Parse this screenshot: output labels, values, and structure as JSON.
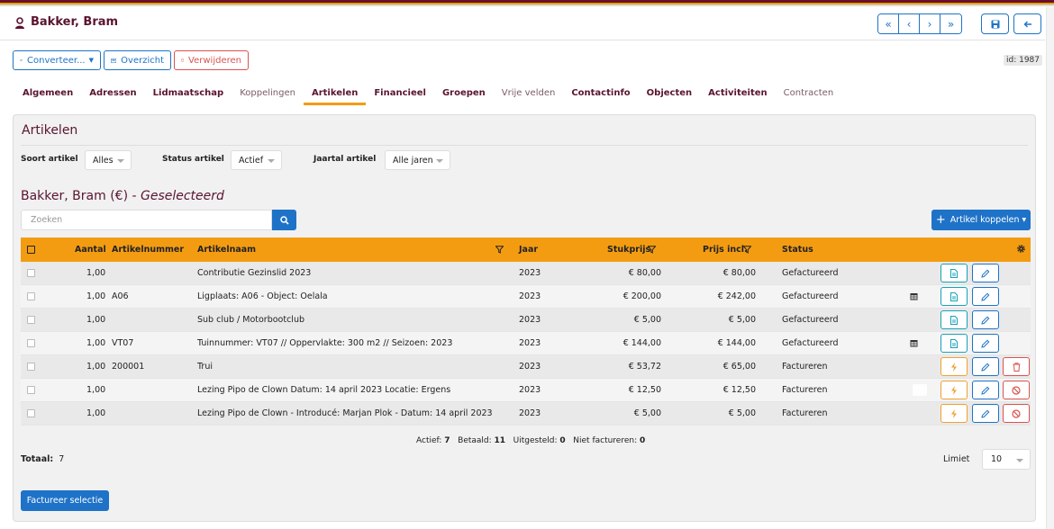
{
  "header": {
    "title": "Bakker, Bram",
    "nav": [
      "«",
      "‹",
      "›",
      "»"
    ],
    "save_icon": "save-icon",
    "back_icon": "arrow-left-icon"
  },
  "toolbar": {
    "convert_label": "Converteer...",
    "overview_label": "Overzicht",
    "delete_label": "Verwijderen",
    "id_label": "id: 1987"
  },
  "tabs": [
    {
      "label": "Algemeen",
      "style": "bold"
    },
    {
      "label": "Adressen",
      "style": "bold"
    },
    {
      "label": "Lidmaatschap",
      "style": "bold"
    },
    {
      "label": "Koppelingen",
      "style": "muted"
    },
    {
      "label": "Artikelen",
      "style": "active"
    },
    {
      "label": "Financieel",
      "style": "bold"
    },
    {
      "label": "Groepen",
      "style": "bold"
    },
    {
      "label": "Vrije velden",
      "style": "muted"
    },
    {
      "label": "Contactinfo",
      "style": "bold"
    },
    {
      "label": "Objecten",
      "style": "bold"
    },
    {
      "label": "Activiteiten",
      "style": "bold"
    },
    {
      "label": "Contracten",
      "style": "muted"
    }
  ],
  "panel": {
    "title": "Artikelen",
    "filters": {
      "soort_label": "Soort artikel",
      "soort_value": "Alles",
      "status_label": "Status artikel",
      "status_value": "Actief",
      "jaartal_label": "Jaartal artikel",
      "jaartal_value": "Alle jaren"
    },
    "subtitle_main": "Bakker, Bram (€) - ",
    "subtitle_em": "Geselecteerd",
    "search_placeholder": "Zoeken",
    "add_label": "Artikel koppelen"
  },
  "table": {
    "headers": {
      "aantal": "Aantal",
      "artikelnummer": "Artikelnummer",
      "artikelnaam": "Artikelnaam",
      "jaar": "Jaar",
      "stukprijs": "Stukprijs",
      "prijs_incl": "Prijs incl.",
      "status": "Status"
    },
    "rows": [
      {
        "aantal": "1,00",
        "nummer": "",
        "naam": "Contributie Gezinslid 2023",
        "jaar": "2023",
        "stukprijs": "€ 80,00",
        "prijs": "€ 80,00",
        "status": "Gefactureerd",
        "calendar": false,
        "type": "invoiced"
      },
      {
        "aantal": "1,00",
        "nummer": "A06",
        "naam": "Ligplaats: A06 - Object: Oelala",
        "jaar": "2023",
        "stukprijs": "€ 200,00",
        "prijs": "€ 242,00",
        "status": "Gefactureerd",
        "calendar": true,
        "type": "invoiced"
      },
      {
        "aantal": "1,00",
        "nummer": "",
        "naam": "Sub club / Motorbootclub",
        "jaar": "2023",
        "stukprijs": "€ 5,00",
        "prijs": "€ 5,00",
        "status": "Gefactureerd",
        "calendar": false,
        "type": "invoiced"
      },
      {
        "aantal": "1,00",
        "nummer": "VT07",
        "naam": "Tuinnummer: VT07 // Oppervlakte: 300 m2 // Seizoen: 2023",
        "jaar": "2023",
        "stukprijs": "€ 144,00",
        "prijs": "€ 144,00",
        "status": "Gefactureerd",
        "calendar": true,
        "type": "invoiced"
      },
      {
        "aantal": "1,00",
        "nummer": "200001",
        "naam": "Trui",
        "jaar": "2023",
        "stukprijs": "€ 53,72",
        "prijs": "€ 65,00",
        "status": "Factureren",
        "calendar": false,
        "type": "delete"
      },
      {
        "aantal": "1,00",
        "nummer": "",
        "naam": "Lezing Pipo de Clown Datum: 14 april 2023 Locatie: Ergens",
        "jaar": "2023",
        "stukprijs": "€ 12,50",
        "prijs": "€ 12,50",
        "status": "Factureren",
        "calendar": false,
        "type": "cancel"
      },
      {
        "aantal": "1,00",
        "nummer": "",
        "naam": "Lezing Pipo de Clown - Introducé: Marjan Plok - Datum: 14 april 2023",
        "jaar": "2023",
        "stukprijs": "€ 5,00",
        "prijs": "€ 5,00",
        "status": "Factureren",
        "calendar": false,
        "type": "cancel"
      }
    ]
  },
  "summary": {
    "actief_label": "Actief:",
    "actief": "7",
    "betaald_label": "Betaald:",
    "betaald": "11",
    "uitgesteld_label": "Uitgesteld:",
    "uitgesteld": "0",
    "niet_label": "Niet factureren:",
    "niet": "0"
  },
  "footer": {
    "totaal_label": "Totaal:",
    "totaal": "7",
    "limiet_label": "Limiet",
    "limiet_value": "10",
    "factureer_label": "Factureer selectie"
  },
  "colors": {
    "accent": "#1e73c8",
    "header_orange": "#f39c12",
    "brand": "#5a1430",
    "danger": "#d9534f"
  }
}
